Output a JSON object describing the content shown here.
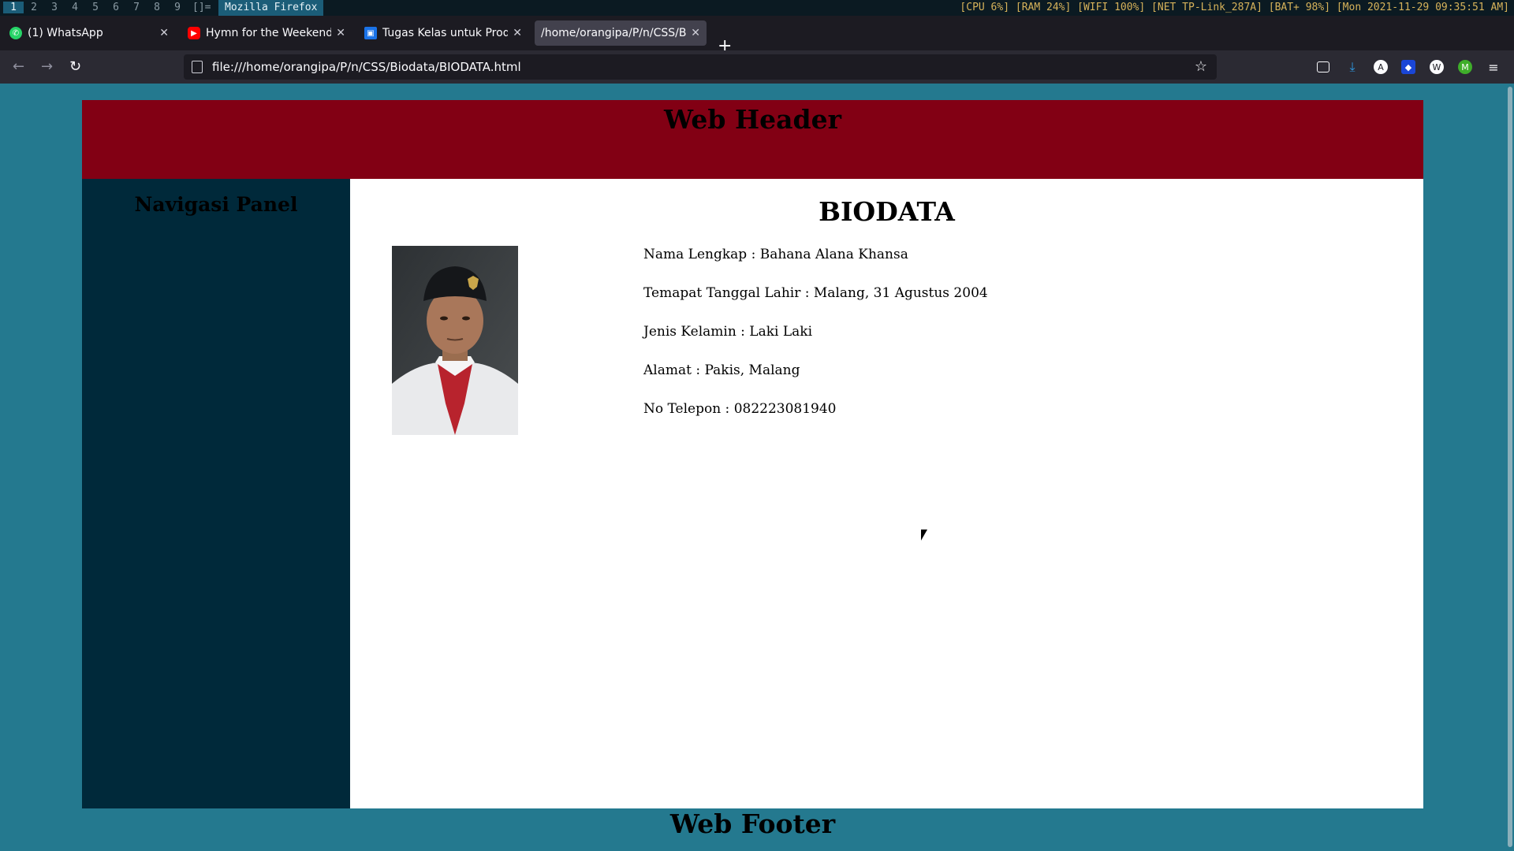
{
  "wm": {
    "workspaces": [
      "1",
      "2",
      "3",
      "4",
      "5",
      "6",
      "7",
      "8",
      "9"
    ],
    "layout": "[]=",
    "window_title": "Mozilla Firefox",
    "status": "[CPU 6%] [RAM 24%] [WIFI 100%] [NET TP-Link_287A] [BAT+ 98%] [Mon 2021-11-29 09:35:51 AM]"
  },
  "tabs": [
    {
      "label": "(1) WhatsApp",
      "icon": "whatsapp-icon",
      "color": "#25d366"
    },
    {
      "label": "Hymn for the Weekend - Y",
      "icon": "youtube-icon",
      "color": "#ff0000"
    },
    {
      "label": "Tugas Kelas untuk Produk",
      "icon": "classroom-icon",
      "color": "#1e8e3e"
    },
    {
      "label": "/home/orangipa/P/n/CSS/Bio",
      "icon": "page-icon",
      "color": "#cfcfd8"
    }
  ],
  "url": "file:///home/orangipa/P/n/CSS/Biodata/BIODATA.html",
  "page": {
    "header": "Web Header",
    "nav_title": "Navigasi Panel",
    "title": "BIODATA",
    "fields": [
      "Nama Lengkap : Bahana Alana Khansa",
      "Temapat Tanggal Lahir : Malang, 31 Agustus 2004",
      "Jenis Kelamin : Laki Laki",
      "Alamat : Pakis, Malang",
      "No Telepon : 082223081940"
    ],
    "footer": "Web Footer"
  },
  "colors": {
    "page_bg": "#24798f",
    "header_bg": "#820014",
    "nav_bg": "#00293a",
    "content_bg": "#ffffff"
  }
}
